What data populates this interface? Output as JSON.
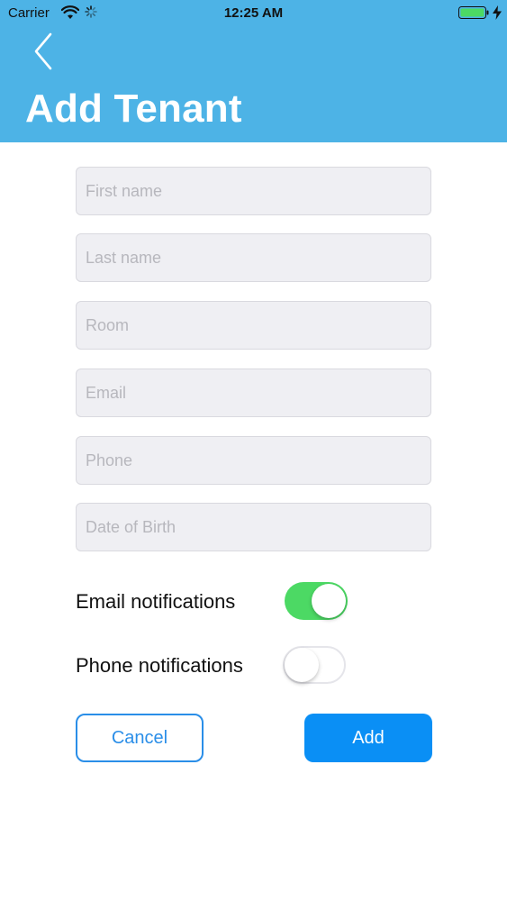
{
  "status_bar": {
    "carrier": "Carrier",
    "time": "12:25 AM",
    "battery_color": "#4cd964"
  },
  "header": {
    "title": "Add Tenant",
    "background": "#4db3e6"
  },
  "form": {
    "first_name": {
      "placeholder": "First name",
      "value": ""
    },
    "last_name": {
      "placeholder": "Last name",
      "value": ""
    },
    "room": {
      "placeholder": "Room",
      "value": ""
    },
    "email": {
      "placeholder": "Email",
      "value": ""
    },
    "phone": {
      "placeholder": "Phone",
      "value": ""
    },
    "dob": {
      "placeholder": "Date of Birth",
      "value": ""
    }
  },
  "toggles": {
    "email_notifications": {
      "label": "Email notifications",
      "on": true
    },
    "phone_notifications": {
      "label": "Phone notifications",
      "on": false
    }
  },
  "actions": {
    "cancel_label": "Cancel",
    "add_label": "Add"
  },
  "icons": {
    "back": "chevron-left-icon",
    "wifi": "wifi-icon",
    "activity": "activity-spinner-icon",
    "battery": "battery-icon",
    "charging": "bolt-icon"
  }
}
